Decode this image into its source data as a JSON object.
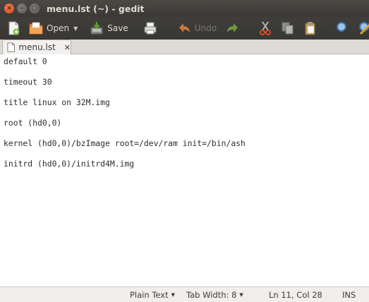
{
  "window": {
    "title": "menu.lst (~) - gedit",
    "controls": {
      "close": "×",
      "minimize": "–",
      "maximize": "□"
    }
  },
  "toolbar": {
    "new_icon": "new-document-icon",
    "open_label": "Open",
    "open_icon": "open-folder-icon",
    "save_label": "Save",
    "save_icon": "save-icon",
    "print_icon": "print-icon",
    "undo_label": "Undo",
    "undo_icon": "undo-icon",
    "redo_icon": "redo-icon",
    "cut_icon": "cut-icon",
    "copy_icon": "copy-icon",
    "paste_icon": "paste-icon",
    "find_icon": "find-icon",
    "replace_icon": "find-replace-icon"
  },
  "tabs": [
    {
      "label": "menu.lst",
      "close": "✕",
      "icon": "document-icon"
    }
  ],
  "editor": {
    "lines": [
      "default 0",
      "timeout 30",
      "title linux on 32M.img",
      "root (hd0,0)",
      "kernel (hd0,0)/bzImage root=/dev/ram init=/bin/ash",
      "initrd (hd0,0)/initrd4M.img"
    ]
  },
  "statusbar": {
    "language": "Plain Text",
    "tab_width": "Tab Width: 8",
    "position": "Ln 11, Col 28",
    "mode": "INS"
  },
  "colors": {
    "titlebar": "#3c3b37",
    "close_button": "#df4a16",
    "editor_bg": "#ffffff",
    "statusbar_bg": "#f1efeb"
  }
}
